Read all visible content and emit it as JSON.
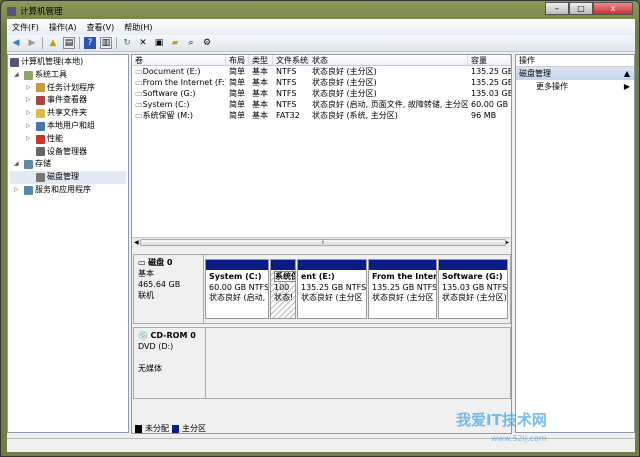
{
  "window": {
    "title": "计算机管理",
    "controls": {
      "minimize": "–",
      "maximize": "□",
      "close": "x"
    }
  },
  "menu": [
    "文件(F)",
    "操作(A)",
    "查看(V)",
    "帮助(H)"
  ],
  "toolbar": [
    "back-icon",
    "forward-icon",
    "up-folder-icon",
    "console-tree-icon",
    "help-icon",
    "show-hide-icon",
    "refresh-icon",
    "delete-icon",
    "properties-icon",
    "open-icon",
    "search-icon",
    "settings-icon"
  ],
  "tree": {
    "root": "计算机管理(本地)",
    "items": [
      {
        "label": "系统工具",
        "level": 1,
        "expander": "◢"
      },
      {
        "label": "任务计划程序",
        "level": 2,
        "expander": "▷"
      },
      {
        "label": "事件查看器",
        "level": 2,
        "expander": "▷"
      },
      {
        "label": "共享文件夹",
        "level": 2,
        "expander": "▷"
      },
      {
        "label": "本地用户和组",
        "level": 2,
        "expander": "▷"
      },
      {
        "label": "性能",
        "level": 2,
        "expander": "▷"
      },
      {
        "label": "设备管理器",
        "level": 2,
        "expander": ""
      },
      {
        "label": "存储",
        "level": 1,
        "expander": "◢"
      },
      {
        "label": "磁盘管理",
        "level": 2,
        "expander": "",
        "selected": true
      },
      {
        "label": "服务和应用程序",
        "level": 1,
        "expander": "▷"
      }
    ]
  },
  "volumes": {
    "columns": [
      "卷",
      "布局",
      "类型",
      "文件系统",
      "状态",
      "容量"
    ],
    "rows": [
      [
        "Document (E:)",
        "简单",
        "基本",
        "NTFS",
        "状态良好 (主分区)",
        "135.25 GB"
      ],
      [
        "From the Internet (F:)",
        "简单",
        "基本",
        "NTFS",
        "状态良好 (主分区)",
        "135.25 GB"
      ],
      [
        "Software (G:)",
        "简单",
        "基本",
        "NTFS",
        "状态良好 (主分区)",
        "135.03 GB"
      ],
      [
        "System (C:)",
        "简单",
        "基本",
        "NTFS",
        "状态良好 (启动, 页面文件, 故障转储, 主分区)",
        "60.00 GB"
      ],
      [
        "系统保留 (M:)",
        "简单",
        "基本",
        "FAT32",
        "状态良好 (系统, 主分区)",
        "96 MB"
      ]
    ]
  },
  "disks": [
    {
      "name": "磁盘 0",
      "type": "基本",
      "size": "465.64 GB",
      "status": "联机",
      "partitions": [
        {
          "name": "System  (C:)",
          "size": "60.00 GB NTFS",
          "status": "状态良好 (启动,"
        },
        {
          "name": "系统保留  (M:)",
          "size": "100",
          "status": "状态!"
        },
        {
          "name": "ent  (E:)",
          "size": "135.25 GB NTFS",
          "status": "状态良好 (主分区"
        },
        {
          "name": "From the Interr",
          "size": "135.25 GB NTFS",
          "status": "状态良好 (主分区"
        },
        {
          "name": "Software  (G:)",
          "size": "135.03 GB NTFS",
          "status": "状态良好 (主分区)"
        }
      ]
    },
    {
      "name": "CD-ROM 0",
      "type": "DVD (D:)",
      "status": "无媒体"
    }
  ],
  "legend": [
    {
      "label": "未分配",
      "color": "#000000"
    },
    {
      "label": "主分区",
      "color": "#0a1c84"
    }
  ],
  "actions": {
    "header": "操作",
    "section": "磁盘管理",
    "items": [
      "更多操作"
    ]
  },
  "watermark": {
    "text": "我爱IT技术网",
    "url": "www.52ij.com"
  }
}
